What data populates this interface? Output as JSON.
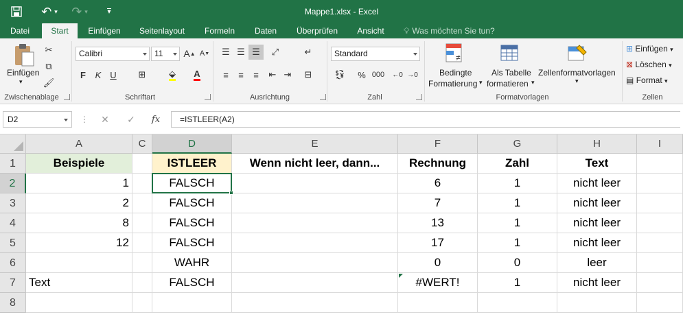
{
  "window": {
    "title": "Mappe1.xlsx - Excel"
  },
  "quick_access": {
    "save": "🖫",
    "undo": "↶",
    "redo": "↷",
    "customize": "⌄"
  },
  "tabs": [
    "Datei",
    "Start",
    "Einfügen",
    "Seitenlayout",
    "Formeln",
    "Daten",
    "Überprüfen",
    "Ansicht"
  ],
  "active_tab": "Start",
  "tell_me": "Was möchten Sie tun?",
  "ribbon": {
    "clipboard": {
      "label": "Zwischenablage",
      "paste": "Einfügen"
    },
    "font": {
      "label": "Schriftart",
      "name": "Calibri",
      "size": "11",
      "bold": "F",
      "italic": "K",
      "underline": "U"
    },
    "alignment": {
      "label": "Ausrichtung"
    },
    "number": {
      "label": "Zahl",
      "format": "Standard",
      "percent": "%",
      "thousands": "000"
    },
    "styles": {
      "label": "Formatvorlagen",
      "conditional": [
        "Bedingte",
        "Formatierung"
      ],
      "as_table": [
        "Als Tabelle",
        "formatieren"
      ],
      "cell_styles": "Zellenformatvorlagen"
    },
    "cells": {
      "label": "Zellen",
      "insert": "Einfügen",
      "delete": "Löschen",
      "format": "Format"
    }
  },
  "formula_bar": {
    "name_box": "D2",
    "formula": "=ISTLEER(A2)",
    "cancel": "✕",
    "enter": "✓",
    "fx": "fx",
    "dots": "⋮"
  },
  "columns": [
    "A",
    "C",
    "D",
    "E",
    "F",
    "G",
    "H",
    "I"
  ],
  "rows": [
    "1",
    "2",
    "3",
    "4",
    "5",
    "6",
    "7",
    "8"
  ],
  "cells": {
    "A": [
      "Beispiele",
      "1",
      "2",
      "8",
      "12",
      "",
      "Text",
      ""
    ],
    "C": [
      "",
      "",
      "",
      "",
      "",
      "",
      "",
      ""
    ],
    "D": [
      "ISTLEER",
      "FALSCH",
      "FALSCH",
      "FALSCH",
      "FALSCH",
      "WAHR",
      "FALSCH",
      ""
    ],
    "E": [
      "Wenn nicht leer, dann...",
      "",
      "",
      "",
      "",
      "",
      "",
      ""
    ],
    "F": [
      "Rechnung",
      "6",
      "7",
      "13",
      "17",
      "0",
      "#WERT!",
      ""
    ],
    "G": [
      "Zahl",
      "1",
      "1",
      "1",
      "1",
      "0",
      "1",
      ""
    ],
    "H": [
      "Text",
      "nicht leer",
      "nicht leer",
      "nicht leer",
      "nicht leer",
      "leer",
      "nicht leer",
      ""
    ],
    "I": [
      "",
      "",
      "",
      "",
      "",
      "",
      "",
      ""
    ]
  },
  "colors": {
    "accent": "#217346",
    "header_a1": "#e2efda",
    "header_d1": "#fff2cc"
  }
}
